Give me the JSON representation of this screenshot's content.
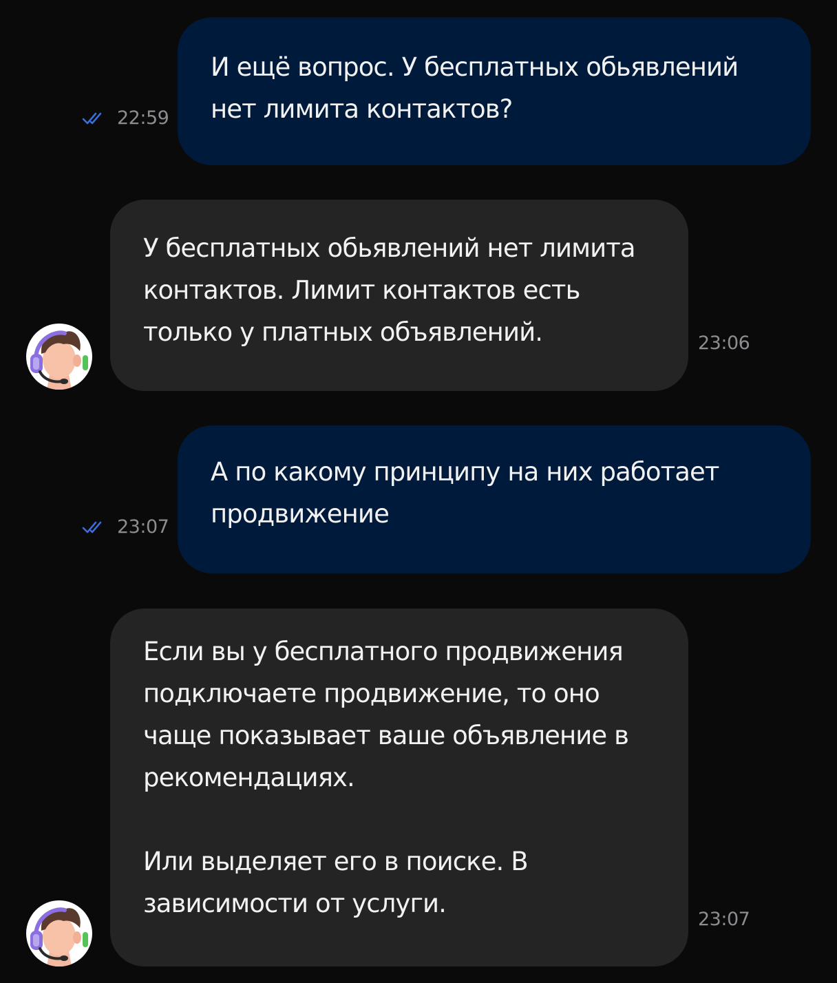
{
  "messages": [
    {
      "direction": "outgoing",
      "text": "И ещё вопрос. У бесплатных обьявлений нет лимита контактов?",
      "time": "22:59",
      "status_icon": "double-check-icon"
    },
    {
      "direction": "incoming",
      "text": "У бесплатных обьявлений нет лимита контактов. Лимит контактов есть только у платных объявлений.",
      "time": "23:06",
      "avatar_icon": "support-agent-avatar"
    },
    {
      "direction": "outgoing",
      "text": "А по какому принципу на них работает продвижение",
      "time": "23:07",
      "status_icon": "double-check-icon"
    },
    {
      "direction": "incoming",
      "text": "Если вы у бесплатного продвижения подключаете продвижение, то оно чаще показывает ваше объявление в рекомендациях.\n\nИли выделяет его в поиске. В зависимости от услуги.",
      "time": "23:07",
      "avatar_icon": "support-agent-avatar"
    }
  ],
  "colors": {
    "background": "#0a0a0a",
    "outgoing_bubble": "#001a3b",
    "incoming_bubble": "#232423",
    "text": "#f2f2f2",
    "timestamp": "#8b8d90",
    "read_check": "#3d6ee0",
    "avatar_headset": "#8b6fe0",
    "avatar_hair": "#5a3a2c"
  }
}
